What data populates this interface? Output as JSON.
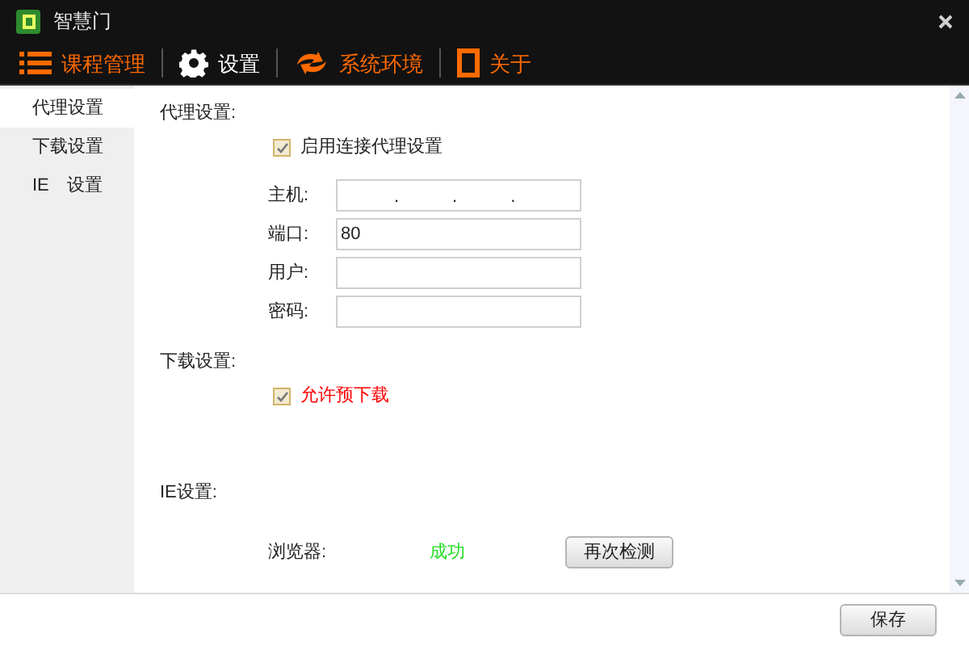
{
  "window": {
    "title": "智慧门"
  },
  "nav": [
    {
      "label": "课程管理",
      "selected": false
    },
    {
      "label": "设置",
      "selected": true
    },
    {
      "label": "系统环境",
      "selected": false
    },
    {
      "label": "关于",
      "selected": false
    }
  ],
  "sidebar": {
    "items": [
      {
        "label": "代理设置",
        "selected": true
      },
      {
        "label": "下载设置",
        "selected": false
      },
      {
        "label": "IE　设置",
        "selected": false
      }
    ]
  },
  "proxy": {
    "heading": "代理设置:",
    "enable": {
      "label": "启用连接代理设置",
      "checked": true
    },
    "fields": [
      {
        "label": "主机:",
        "value": ".　　　.　　　."
      },
      {
        "label": "端口:",
        "value": "80"
      },
      {
        "label": "用户:"
      },
      {
        "label": "密码:"
      }
    ]
  },
  "download": {
    "heading": "下载设置:",
    "allow": {
      "label": "允许预下载",
      "checked": true
    }
  },
  "ie": {
    "heading": "IE设置:",
    "rows": [
      {
        "label": "浏览器:",
        "status": "成功"
      }
    ],
    "button": "再次检测"
  },
  "footer": {
    "save": "保存"
  }
}
